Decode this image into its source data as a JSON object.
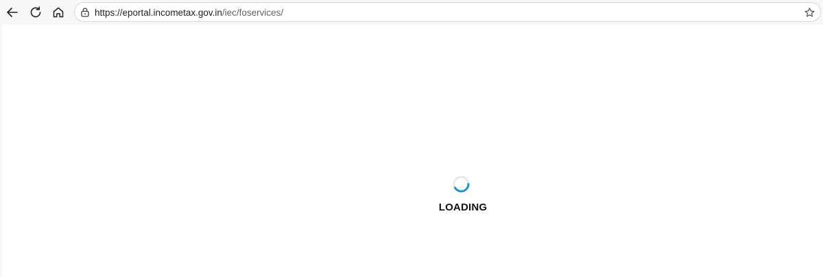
{
  "browser": {
    "url_host": "https://eportal.incometax.gov.in",
    "url_path": "/iec/foservices/",
    "icons": {
      "back": "arrow-left-icon",
      "reload": "reload-icon",
      "home": "home-icon",
      "lock": "lock-icon",
      "favorite": "star-icon"
    }
  },
  "page": {
    "loading_text": "LOADING",
    "spinner_color": "#1f8fd6",
    "spinner_track_color": "#e4e8ec"
  }
}
